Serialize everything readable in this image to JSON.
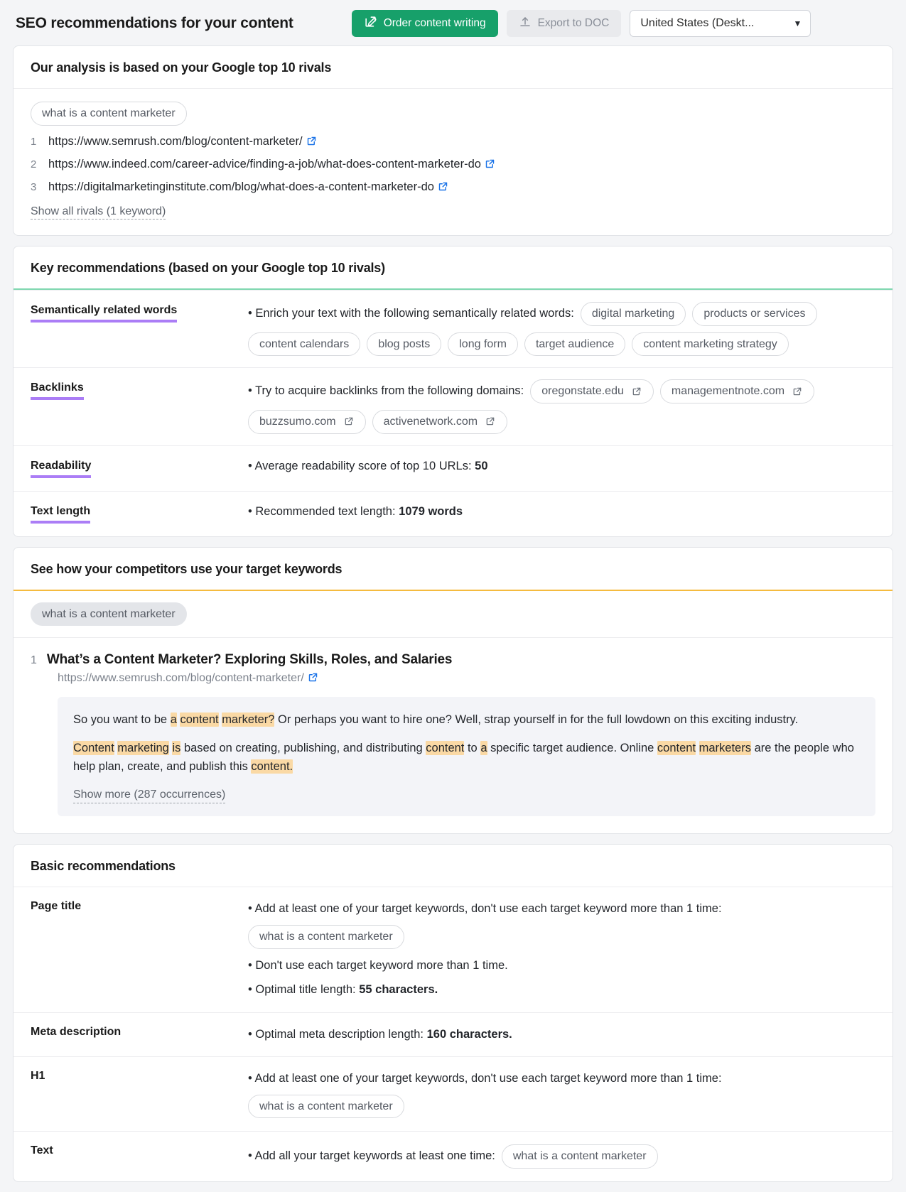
{
  "header": {
    "title": "SEO recommendations for your content",
    "order_button": "Order content writing",
    "order_icon": "edit-square-icon",
    "export_button": "Export to DOC",
    "export_icon": "upload-icon",
    "locale_select_value": "United States (Deskt...",
    "chevron_icon": "chevron-down-icon"
  },
  "rivals": {
    "title": "Our analysis is based on your Google top 10 rivals",
    "keyword_pill": "what is a content marketer",
    "items": [
      {
        "index": "1",
        "url": "https://www.semrush.com/blog/content-marketer/"
      },
      {
        "index": "2",
        "url": "https://www.indeed.com/career-advice/finding-a-job/what-does-content-marketer-do"
      },
      {
        "index": "3",
        "url": "https://digitalmarketinginstitute.com/blog/what-does-a-content-marketer-do"
      }
    ],
    "show_all_link": "Show all rivals (1 keyword)",
    "link_icon": "external-link-icon"
  },
  "key_recommendations": {
    "title": "Key recommendations (based on your Google top 10 rivals)",
    "accent_color": "#7fd7b0",
    "underline_color": "#ab7df6",
    "rows": [
      {
        "label": "Semantically related words",
        "lead": "Enrich your text with the following semantically related words:",
        "chips": [
          "digital marketing",
          "products or services",
          "content calendars",
          "blog posts",
          "long form",
          "target audience",
          "content marketing strategy"
        ]
      },
      {
        "label": "Backlinks",
        "lead": "Try to acquire backlinks from the following domains:",
        "chips": [
          "oregonstate.edu",
          "managementnote.com",
          "buzzsumo.com",
          "activenetwork.com"
        ]
      },
      {
        "label": "Readability",
        "lead": "Average readability score of top 10 URLs:",
        "value": "50"
      },
      {
        "label": "Text length",
        "lead": "Recommended text length:",
        "value": "1079 words"
      }
    ]
  },
  "competitors": {
    "title": "See how your competitors use your target keywords",
    "accent_color": "#f5bb3f",
    "keyword_pill": "what is a content marketer",
    "item": {
      "index": "1",
      "title": "What’s a Content Marketer? Exploring Skills, Roles, and Salaries",
      "url": "https://www.semrush.com/blog/content-marketer/",
      "paragraph1": [
        {
          "t": "So you want to be ",
          "h": false
        },
        {
          "t": "a",
          "h": true
        },
        {
          "t": " ",
          "h": false
        },
        {
          "t": "content",
          "h": true
        },
        {
          "t": " ",
          "h": false
        },
        {
          "t": "marketer?",
          "h": true
        },
        {
          "t": " Or perhaps you want to hire one? Well, strap yourself in for the full lowdown on this exciting industry.",
          "h": false
        }
      ],
      "paragraph2": [
        {
          "t": "Content",
          "h": true
        },
        {
          "t": " ",
          "h": false
        },
        {
          "t": "marketing",
          "h": true
        },
        {
          "t": " ",
          "h": false
        },
        {
          "t": "is",
          "h": true
        },
        {
          "t": " based on creating, publishing, and distributing ",
          "h": false
        },
        {
          "t": "content",
          "h": true
        },
        {
          "t": " to ",
          "h": false
        },
        {
          "t": "a",
          "h": true
        },
        {
          "t": " specific target audience. Online ",
          "h": false
        },
        {
          "t": "content",
          "h": true
        },
        {
          "t": " ",
          "h": false
        },
        {
          "t": "marketers",
          "h": true
        },
        {
          "t": " are the people who help plan, create, and publish this ",
          "h": false
        },
        {
          "t": "content.",
          "h": true
        }
      ],
      "show_more": "Show more (287 occurrences)",
      "highlight_color": "#fad9a5"
    }
  },
  "basic_recommendations": {
    "title": "Basic recommendations",
    "rows": [
      {
        "label": "Page title",
        "lines": [
          {
            "type": "bullet_chip",
            "text": "Add at least one of your target keywords, don't use each target keyword more than 1 time:",
            "chip": "what is a content marketer"
          },
          {
            "type": "bullet",
            "text": "Don't use each target keyword more than 1 time."
          },
          {
            "type": "bullet_value",
            "text": "Optimal title length:",
            "value": "55 characters."
          }
        ]
      },
      {
        "label": "Meta description",
        "lines": [
          {
            "type": "bullet_value",
            "text": "Optimal meta description length:",
            "value": "160 characters."
          }
        ]
      },
      {
        "label": "H1",
        "lines": [
          {
            "type": "bullet_chip",
            "text": "Add at least one of your target keywords, don't use each target keyword more than 1 time:",
            "chip": "what is a content marketer"
          }
        ]
      },
      {
        "label": "Text",
        "lines": [
          {
            "type": "bullet_inline_chip",
            "text": "Add all your target keywords at least one time:",
            "chip": "what is a content marketer"
          }
        ]
      }
    ]
  }
}
